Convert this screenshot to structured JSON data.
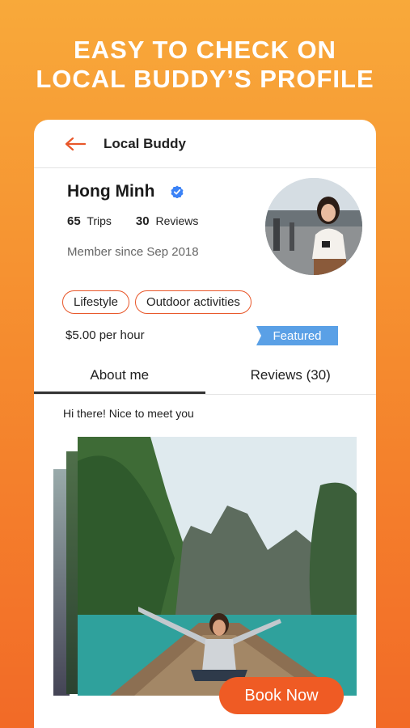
{
  "headline": {
    "line1": "EASY TO CHECK ON",
    "line2": "LOCAL BUDDY’S PROFILE"
  },
  "topbar": {
    "title": "Local Buddy",
    "back_icon": "back-arrow-icon"
  },
  "profile": {
    "name": "Hong Minh",
    "verified_icon": "verified-badge-icon",
    "trips_count": "65",
    "trips_label": "Trips",
    "reviews_count": "30",
    "reviews_label": "Reviews",
    "member_since": "Member since Sep 2018"
  },
  "tags": [
    "Lifestyle",
    "Outdoor activities"
  ],
  "price": "$5.00 per hour",
  "featured_label": "Featured",
  "tabs": [
    {
      "label": "About me",
      "active": true
    },
    {
      "label": "Reviews (30)",
      "active": false
    }
  ],
  "greeting": "Hi there! Nice to meet you",
  "book_button": "Book Now",
  "colors": {
    "accent": "#ef5b24",
    "featured": "#5aa0e6",
    "verified": "#3b82f6"
  }
}
